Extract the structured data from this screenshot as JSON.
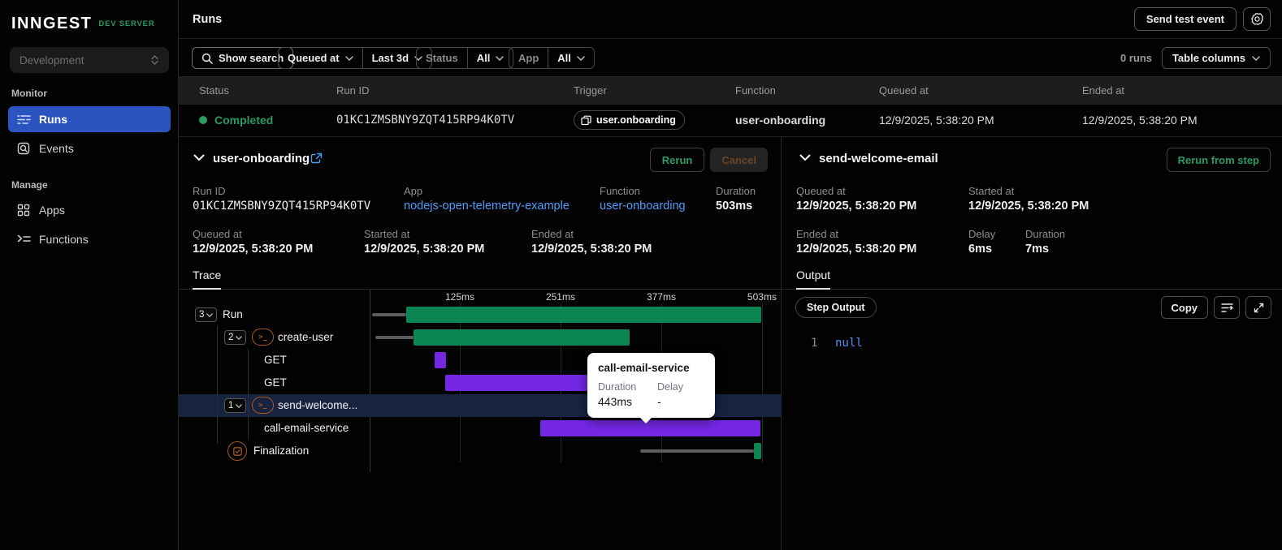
{
  "sidebar": {
    "logo": "INNGEST",
    "logo_badge": "DEV SERVER",
    "env_select": "Development",
    "monitor_label": "Monitor",
    "manage_label": "Manage",
    "items": {
      "runs": "Runs",
      "events": "Events",
      "apps": "Apps",
      "functions": "Functions"
    }
  },
  "header": {
    "title": "Runs",
    "send_test_event": "Send test event"
  },
  "filters": {
    "show_search": "Show search",
    "queued_at": "Queued at",
    "time_range": "Last 3d",
    "status_label": "Status",
    "status_value": "All",
    "app_label": "App",
    "app_value": "All",
    "runs_count": "0 runs",
    "table_columns": "Table columns"
  },
  "table": {
    "columns": [
      "Status",
      "Run ID",
      "Trigger",
      "Function",
      "Queued at",
      "Ended at"
    ],
    "row": {
      "status": "Completed",
      "run_id": "01KC1ZMSBNY9ZQT415RP94K0TV",
      "trigger": "user.onboarding",
      "function": "user-onboarding",
      "queued_at": "12/9/2025, 5:38:20 PM",
      "ended_at": "12/9/2025, 5:38:20 PM"
    }
  },
  "run_details": {
    "name": "user-onboarding",
    "rerun": "Rerun",
    "cancel": "Cancel",
    "run_id_label": "Run ID",
    "run_id": "01KC1ZMSBNY9ZQT415RP94K0TV",
    "app_label": "App",
    "app": "nodejs-open-telemetry-example",
    "function_label": "Function",
    "function": "user-onboarding",
    "duration_label": "Duration",
    "duration": "503ms",
    "queued_label": "Queued at",
    "queued_at": "12/9/2025, 5:38:20 PM",
    "started_label": "Started at",
    "started_at": "12/9/2025, 5:38:20 PM",
    "ended_label": "Ended at",
    "ended_at": "12/9/2025, 5:38:20 PM",
    "tab": "Trace"
  },
  "trace": {
    "type": "gantt",
    "axis_ticks": [
      {
        "label": "125ms",
        "ms": 125
      },
      {
        "label": "251ms",
        "ms": 251
      },
      {
        "label": "377ms",
        "ms": 377
      },
      {
        "label": "503ms",
        "ms": 503
      }
    ],
    "colors": {
      "green": "#0b8552",
      "purple": "#7428e4",
      "delay": "#5c5c5c"
    },
    "rows": [
      {
        "label": "Run",
        "badge": "3",
        "icon": null,
        "indent": "root",
        "selected": false,
        "delay": [
          15,
          58
        ],
        "bar": {
          "start": 58,
          "end": 502,
          "color": "green"
        }
      },
      {
        "label": "create-user",
        "badge": "2",
        "icon": "terminal",
        "indent": "step",
        "selected": false,
        "delay": [
          19,
          67
        ],
        "bar": {
          "start": 67,
          "end": 337,
          "color": "green"
        }
      },
      {
        "label": "GET",
        "badge": null,
        "icon": null,
        "indent": "http",
        "selected": false,
        "delay": null,
        "bar": {
          "start": 94,
          "end": 108,
          "color": "purple"
        }
      },
      {
        "label": "GET",
        "badge": null,
        "icon": null,
        "indent": "http",
        "selected": false,
        "delay": null,
        "bar": {
          "start": 107,
          "end": 318,
          "color": "purple"
        }
      },
      {
        "label": "send-welcome...",
        "badge": "1",
        "icon": "terminal",
        "indent": "step",
        "selected": true,
        "delay": null,
        "bar": {
          "start": 337,
          "end": 354,
          "color": "green"
        }
      },
      {
        "label": "call-email-service",
        "badge": null,
        "icon": null,
        "indent": "http",
        "selected": false,
        "delay": null,
        "bar": {
          "start": 226,
          "end": 501,
          "color": "purple"
        }
      },
      {
        "label": "Finalization",
        "badge": null,
        "icon": "check",
        "indent": "final",
        "selected": false,
        "delay": [
          351,
          493
        ],
        "bar": {
          "start": 493,
          "end": 502,
          "color": "green"
        }
      }
    ],
    "tooltip": {
      "title": "call-email-service",
      "duration_label": "Duration",
      "delay_label": "Delay",
      "duration": "443ms",
      "delay": "-"
    }
  },
  "step_details": {
    "name": "send-welcome-email",
    "rerun_from_step": "Rerun from step",
    "queued_label": "Queued at",
    "queued_at": "12/9/2025, 5:38:20 PM",
    "started_label": "Started at",
    "started_at": "12/9/2025, 5:38:20 PM",
    "ended_label": "Ended at",
    "ended_at": "12/9/2025, 5:38:20 PM",
    "delay_label": "Delay",
    "delay": "6ms",
    "duration_label": "Duration",
    "duration": "7ms",
    "tab": "Output"
  },
  "output": {
    "chip": "Step Output",
    "copy": "Copy",
    "line_number": "1",
    "value": "null"
  }
}
